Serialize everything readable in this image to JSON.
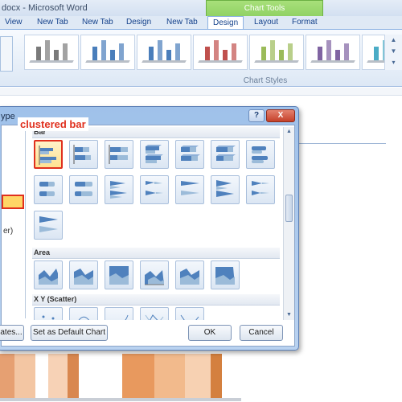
{
  "window": {
    "title": "docx - Microsoft Word",
    "context_group": "Chart Tools"
  },
  "tabs": [
    {
      "label": "View"
    },
    {
      "label": "New Tab"
    },
    {
      "label": "New Tab"
    },
    {
      "label": "Design"
    },
    {
      "label": "New Tab"
    },
    {
      "label": "Design",
      "active": true
    },
    {
      "label": "Layout"
    },
    {
      "label": "Format"
    }
  ],
  "ribbon": {
    "group_label": "Chart Styles",
    "style_colors": [
      "#7a7a7a",
      "#4a7ebb",
      "#4a7ebb",
      "#c0504d",
      "#9bbb59",
      "#8064a2",
      "#4bacc6"
    ]
  },
  "dialog": {
    "title": "ype",
    "help_label": "?",
    "close_label": "X",
    "sidebar_fragment": "er)",
    "sections": {
      "top_cut": "Bar",
      "area": "Area",
      "scatter": "X Y (Scatter)"
    },
    "buttons": {
      "templates": "ates...",
      "set_default": "Set as Default Chart",
      "ok": "OK",
      "cancel": "Cancel"
    }
  },
  "annotation": {
    "label": "clustered bar",
    "color": "#e0301e"
  },
  "icons": {
    "dropdown": "chevron-down-icon",
    "scroll_up": "triangle-up-icon",
    "scroll_down": "triangle-down-icon"
  }
}
